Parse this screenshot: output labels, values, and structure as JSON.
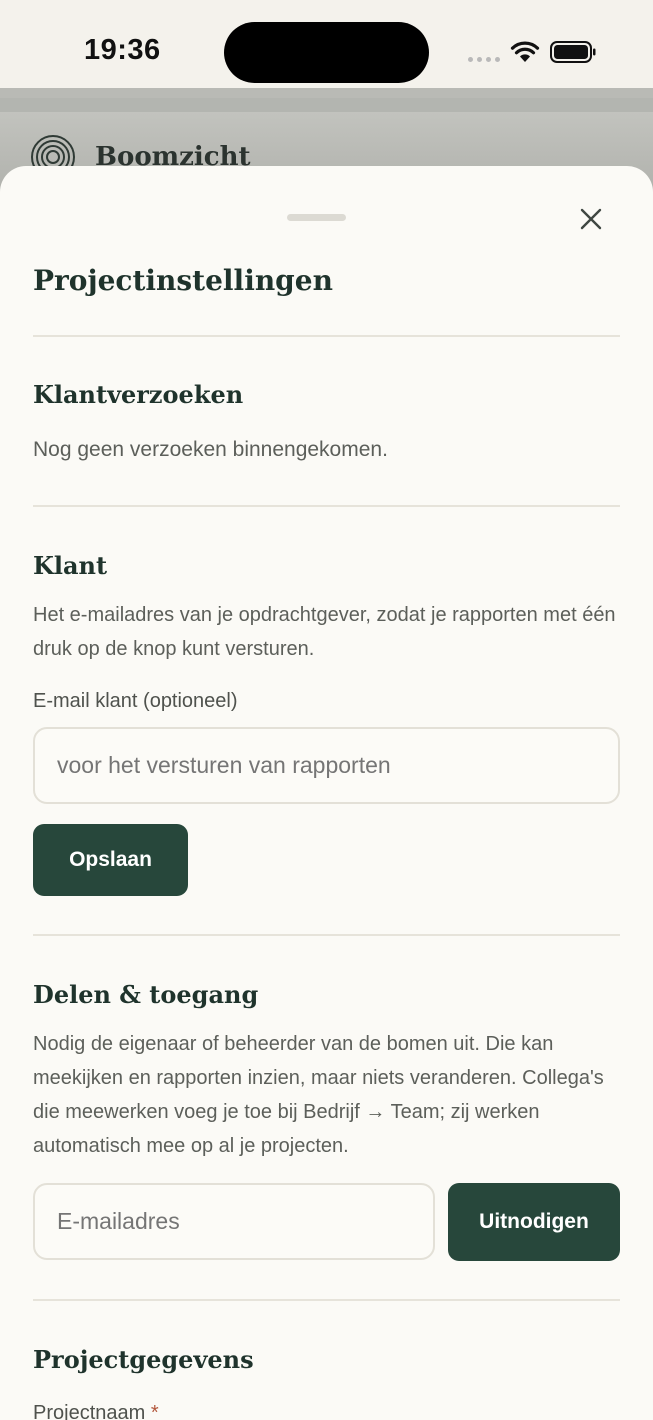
{
  "status_bar": {
    "time": "19:36"
  },
  "app": {
    "name": "Boomzicht"
  },
  "sheet": {
    "title": "Projectinstellingen",
    "client_requests": {
      "title": "Klantverzoeken",
      "empty_text": "Nog geen verzoeken binnengekomen."
    },
    "client": {
      "title": "Klant",
      "description": "Het e-mailadres van je opdrachtgever, zodat je rapporten met één druk op de knop kunt versturen.",
      "email_label": "E-mail klant (optioneel)",
      "email_value": "",
      "email_placeholder": "voor het versturen van rapporten",
      "save_label": "Opslaan"
    },
    "sharing": {
      "title": "Delen & toegang",
      "description": "Nodig de eigenaar of beheerder van de bomen uit. Die kan meekijken en rapporten inzien, maar niets veranderen. Collega's die meewerken voeg je toe bij Bedrijf → Team; zij werken automatisch mee op al je projecten.",
      "email_value": "",
      "email_placeholder": "E-mailadres",
      "invite_label": "Uitnodigen"
    },
    "project_details": {
      "title": "Projectgegevens",
      "name_label": "Projectnaam",
      "required_marker": "*"
    }
  },
  "colors": {
    "primary": "#27473b",
    "heading": "#1f332c",
    "sheet_background": "#fbfaf6",
    "required": "#b2573c"
  },
  "icons": {
    "close": "close-icon",
    "logo": "tree-rings-logo-icon",
    "wifi": "wifi-icon",
    "battery": "battery-icon"
  }
}
